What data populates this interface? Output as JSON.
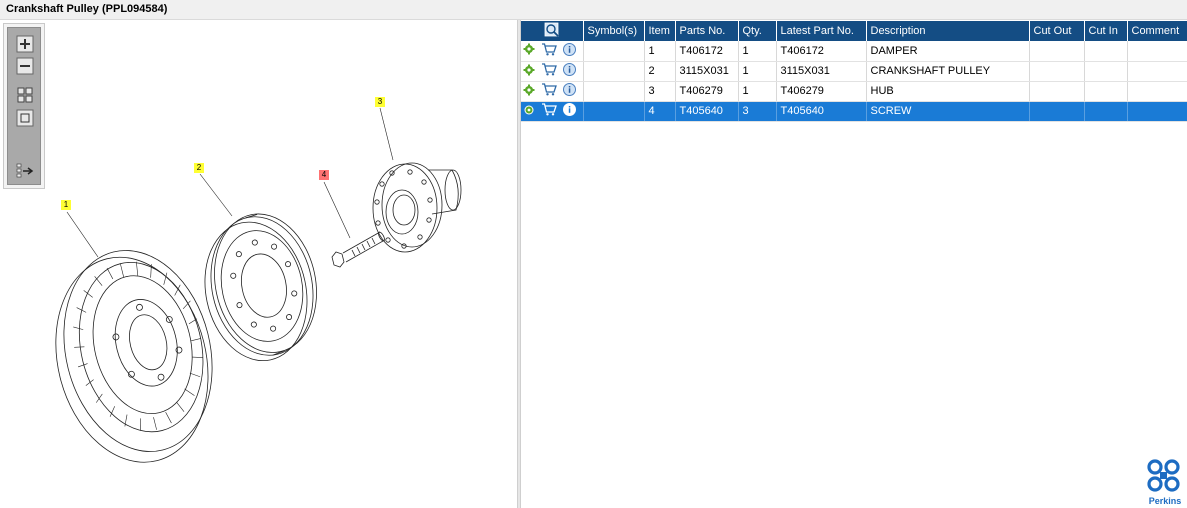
{
  "window": {
    "title": "Crankshaft Pulley (PPL094584)"
  },
  "toolbar": {
    "buttons": [
      {
        "icon": "zoom-in-icon"
      },
      {
        "icon": "zoom-out-icon"
      },
      {
        "icon": "fit-all-icon"
      },
      {
        "icon": "actual-size-icon"
      },
      {
        "icon": "export-list-icon"
      }
    ]
  },
  "diagram": {
    "callouts": [
      {
        "label": "1",
        "color": "#ffff33"
      },
      {
        "label": "2",
        "color": "#ffff33"
      },
      {
        "label": "3",
        "color": "#ffff33"
      },
      {
        "label": "4",
        "color": "#ff7373",
        "highlighted": true
      }
    ]
  },
  "table": {
    "columns": [
      "",
      "Symbol(s)",
      "Item",
      "Parts No.",
      "Qty.",
      "Latest Part No.",
      "Description",
      "Cut Out",
      "Cut In",
      "Comment"
    ],
    "header_icon": "view-details-icon",
    "row_icons": [
      "gear-icon",
      "cart-icon",
      "info-icon"
    ],
    "rows": [
      {
        "symbols": "",
        "item": "1",
        "part_no": "T406172",
        "qty": "1",
        "latest_part_no": "T406172",
        "description": "DAMPER",
        "cut_out": "",
        "cut_in": "",
        "comment": ""
      },
      {
        "symbols": "",
        "item": "2",
        "part_no": "3115X031",
        "qty": "1",
        "latest_part_no": "3115X031",
        "description": "CRANKSHAFT PULLEY",
        "cut_out": "",
        "cut_in": "",
        "comment": ""
      },
      {
        "symbols": "",
        "item": "3",
        "part_no": "T406279",
        "qty": "1",
        "latest_part_no": "T406279",
        "description": "HUB",
        "cut_out": "",
        "cut_in": "",
        "comment": ""
      },
      {
        "symbols": "",
        "item": "4",
        "part_no": "T405640",
        "qty": "3",
        "latest_part_no": "T405640",
        "description": "SCREW",
        "cut_out": "",
        "cut_in": "",
        "comment": "",
        "selected": true
      }
    ]
  },
  "branding": {
    "logo_text": "Perkins",
    "color": "#1d6cc2"
  },
  "colors": {
    "header": "#144d84",
    "selected_row": "#1a7bd6"
  }
}
